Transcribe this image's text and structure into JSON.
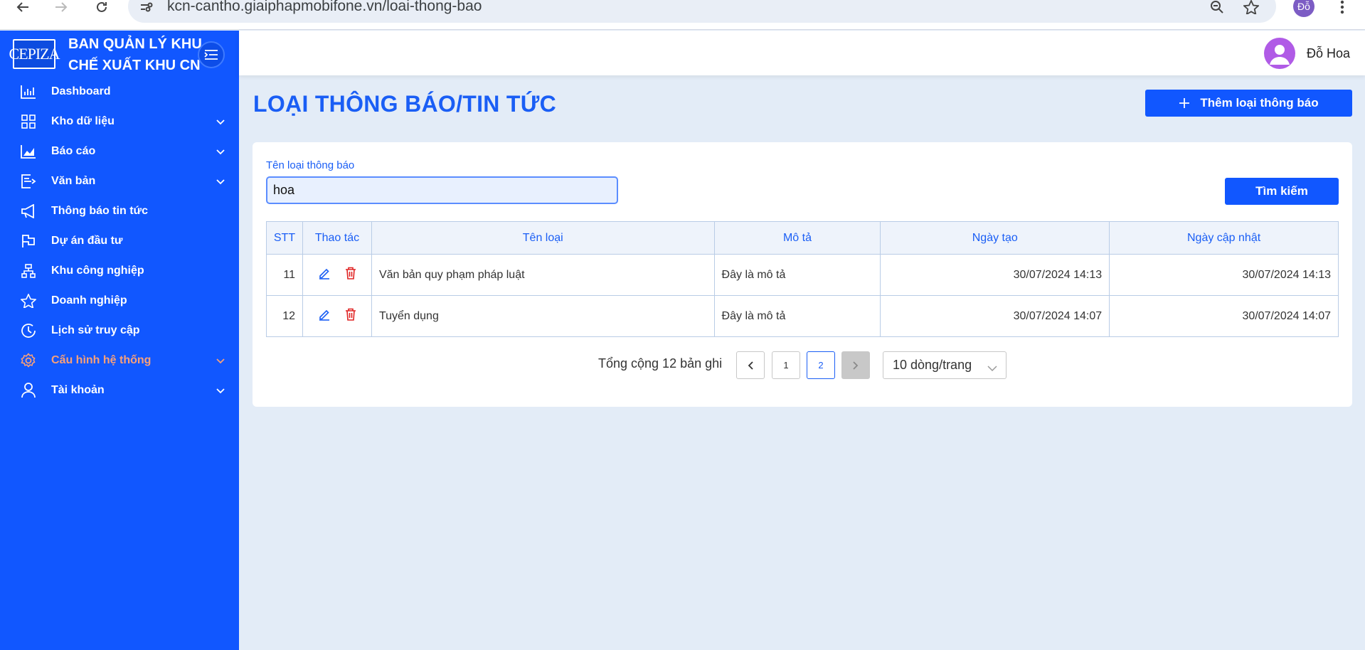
{
  "browser": {
    "url": "kcn-cantho.giaiphapmobifone.vn/loai-thong-bao",
    "profile_initials": "Đỗ"
  },
  "sidebar": {
    "logo_text": "CEPIZA",
    "brand_title": "BAN QUẢN LÝ KHU CHẾ XUẤT KHU CN",
    "items": [
      {
        "label": "Dashboard",
        "icon": "bar-chart-icon",
        "has_children": false
      },
      {
        "label": "Kho dữ liệu",
        "icon": "grid-icon",
        "has_children": true
      },
      {
        "label": "Báo cáo",
        "icon": "area-chart-icon",
        "has_children": true
      },
      {
        "label": "Văn bản",
        "icon": "document-export-icon",
        "has_children": true
      },
      {
        "label": "Thông báo tin tức",
        "icon": "megaphone-icon",
        "has_children": false
      },
      {
        "label": "Dự án đầu tư",
        "icon": "flag-icon",
        "has_children": false
      },
      {
        "label": "Khu công nghiệp",
        "icon": "hierarchy-icon",
        "has_children": false
      },
      {
        "label": "Doanh nghiệp",
        "icon": "star-icon",
        "has_children": false
      },
      {
        "label": "Lịch sử truy cập",
        "icon": "clock-icon",
        "has_children": false
      },
      {
        "label": "Cấu hình hệ thống",
        "icon": "gear-icon",
        "has_children": true,
        "active": true
      },
      {
        "label": "Tài khoản",
        "icon": "user-icon",
        "has_children": true
      }
    ]
  },
  "header": {
    "username": "Đỗ Hoa"
  },
  "page": {
    "title": "LOẠI THÔNG BÁO/TIN TỨC",
    "add_button": "Thêm loại thông báo"
  },
  "filter": {
    "label": "Tên loại thông báo",
    "value": "hoa",
    "search_button": "Tìm kiếm"
  },
  "table": {
    "columns": [
      "STT",
      "Thao tác",
      "Tên loại",
      "Mô tả",
      "Ngày tạo",
      "Ngày cập nhật"
    ],
    "rows": [
      {
        "stt": "11",
        "ten_loai": "Văn bản quy phạm pháp luật",
        "mo_ta": "Đây là mô tả",
        "ngay_tao": "30/07/2024 14:13",
        "ngay_cap_nhat": "30/07/2024 14:13"
      },
      {
        "stt": "12",
        "ten_loai": "Tuyển dụng",
        "mo_ta": "Đây là mô tả",
        "ngay_tao": "30/07/2024 14:07",
        "ngay_cap_nhat": "30/07/2024 14:07"
      }
    ]
  },
  "pagination": {
    "total_text": "Tổng cộng 12 bản ghi",
    "pages": [
      "1",
      "2"
    ],
    "current_page": "2",
    "page_size": "10 dòng/trang"
  },
  "colors": {
    "primary": "#1157ff",
    "title": "#1a5ef5",
    "active_menu": "#f7a07a",
    "delete": "#e02424",
    "background": "#e3ecf7"
  }
}
